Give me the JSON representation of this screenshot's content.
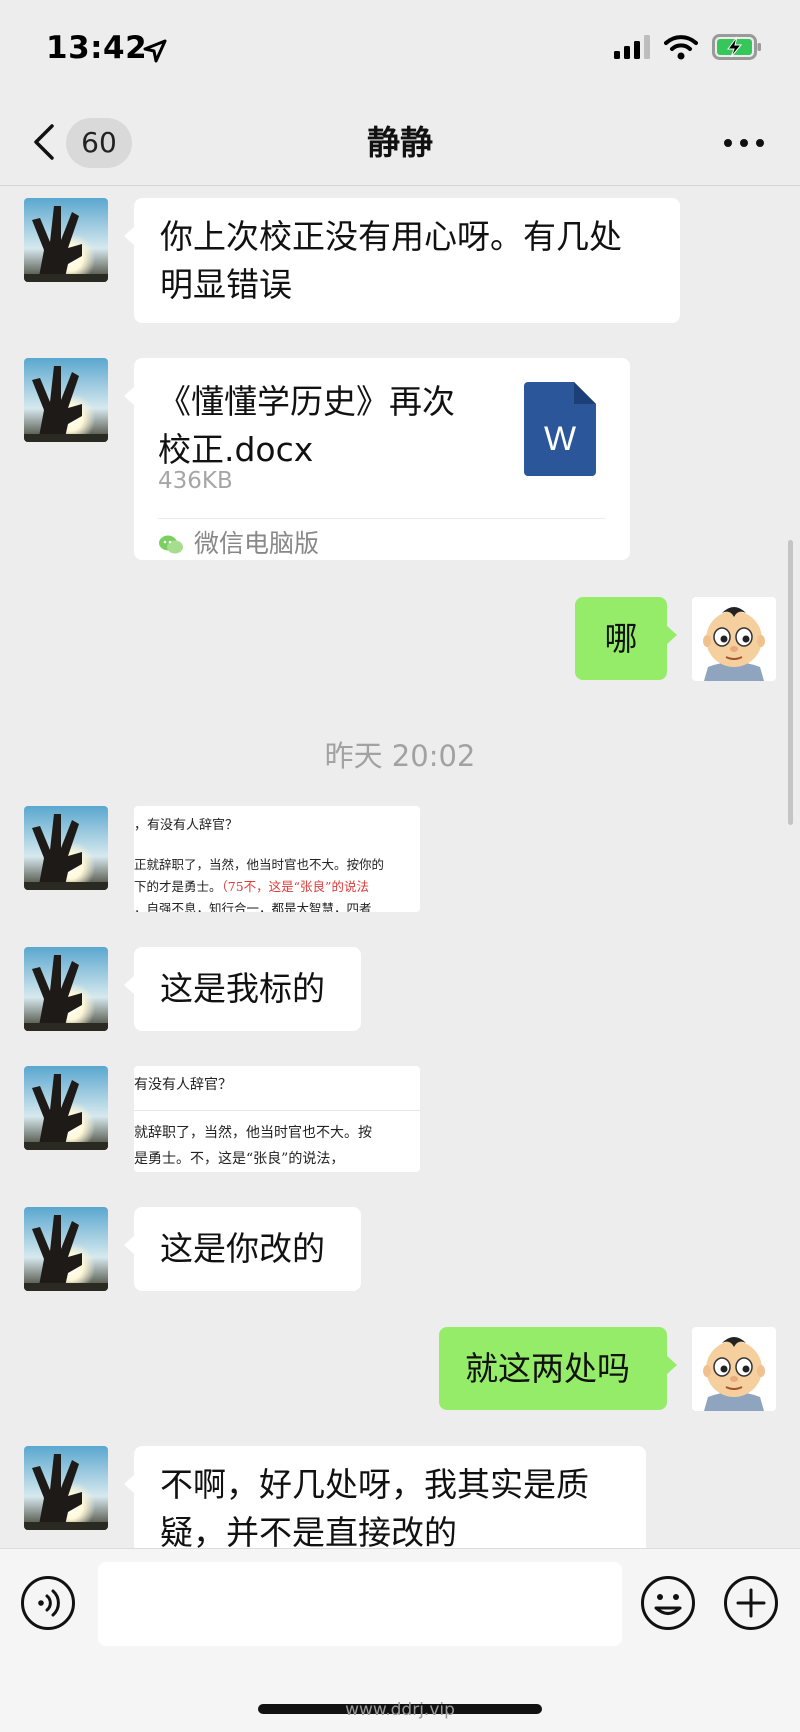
{
  "status": {
    "time": "13:42"
  },
  "nav": {
    "back_count": "60",
    "title": "静静"
  },
  "messages": {
    "m1": "你上次校正没有用心呀。有几处明显错误",
    "file": {
      "name": "《懂懂学历史》再次校正.docx",
      "size": "436KB",
      "source": "微信电脑版",
      "word_letter": "W"
    },
    "m3": "哪",
    "timestamp": "昨天 20:02",
    "img1": {
      "line1": "，有没有人辞官？",
      "line2a": "正就辞职了，当然，他当时官也不大。按你的",
      "line3a": "下的才是勇士。",
      "line3b": "（75不，这是“张良”的说法",
      "line4": "，自强不息，知行合一，都是大智慧，四者"
    },
    "m5": "这是我标的",
    "img2": {
      "line1": "有没有人辞官？",
      "line2": "就辞职了，当然，他当时官也不大。按",
      "line3": "是勇士。不，这是“张良”的说法，"
    },
    "m7": "这是你改的",
    "m8": "就这两处吗",
    "m9": "不啊，好几处呀，我其实是质疑，并不是直接改的"
  },
  "input": {
    "placeholder": ""
  },
  "watermark": "www.ddrj.vip",
  "colors": {
    "green_bubble": "#95ec69",
    "background": "#ededed",
    "word_blue": "#2b579a"
  },
  "icons": [
    "navigation-arrow-icon",
    "signal-icon",
    "wifi-icon",
    "battery-charging-icon",
    "back-chevron-icon",
    "more-icon",
    "word-file-icon",
    "wechat-small-icon",
    "voice-icon",
    "emoji-icon",
    "plus-icon"
  ]
}
